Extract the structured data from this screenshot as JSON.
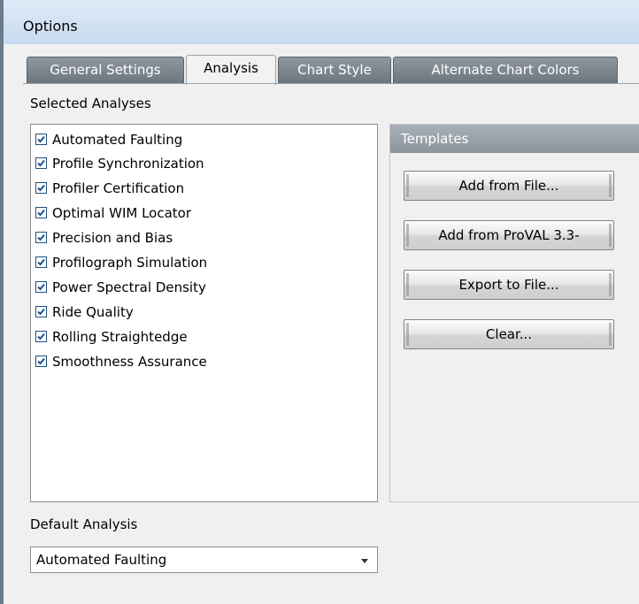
{
  "window": {
    "title": "Options"
  },
  "tabs": [
    {
      "label": "General Settings",
      "active": false
    },
    {
      "label": "Analysis",
      "active": true
    },
    {
      "label": "Chart Style",
      "active": false
    },
    {
      "label": "Alternate Chart Colors",
      "active": false
    }
  ],
  "selected_analyses": {
    "label": "Selected Analyses",
    "items": [
      {
        "label": "Automated Faulting",
        "checked": true
      },
      {
        "label": "Profile Synchronization",
        "checked": true
      },
      {
        "label": "Profiler Certification",
        "checked": true
      },
      {
        "label": "Optimal WIM Locator",
        "checked": true
      },
      {
        "label": "Precision and Bias",
        "checked": true
      },
      {
        "label": "Profilograph Simulation",
        "checked": true
      },
      {
        "label": "Power Spectral Density",
        "checked": true
      },
      {
        "label": "Ride Quality",
        "checked": true
      },
      {
        "label": "Rolling Straightedge",
        "checked": true
      },
      {
        "label": "Smoothness Assurance",
        "checked": true
      }
    ]
  },
  "templates": {
    "header": "Templates",
    "buttons": [
      {
        "label": "Add from File..."
      },
      {
        "label": "Add from ProVAL 3.3-"
      },
      {
        "label": "Export to File..."
      },
      {
        "label": "Clear..."
      }
    ]
  },
  "default_analysis": {
    "label": "Default Analysis",
    "value": "Automated Faulting"
  },
  "colors": {
    "checkbox_check": "#1f4f8b",
    "tab_inactive": "#7b858e",
    "group_header": "#99a2aa"
  }
}
